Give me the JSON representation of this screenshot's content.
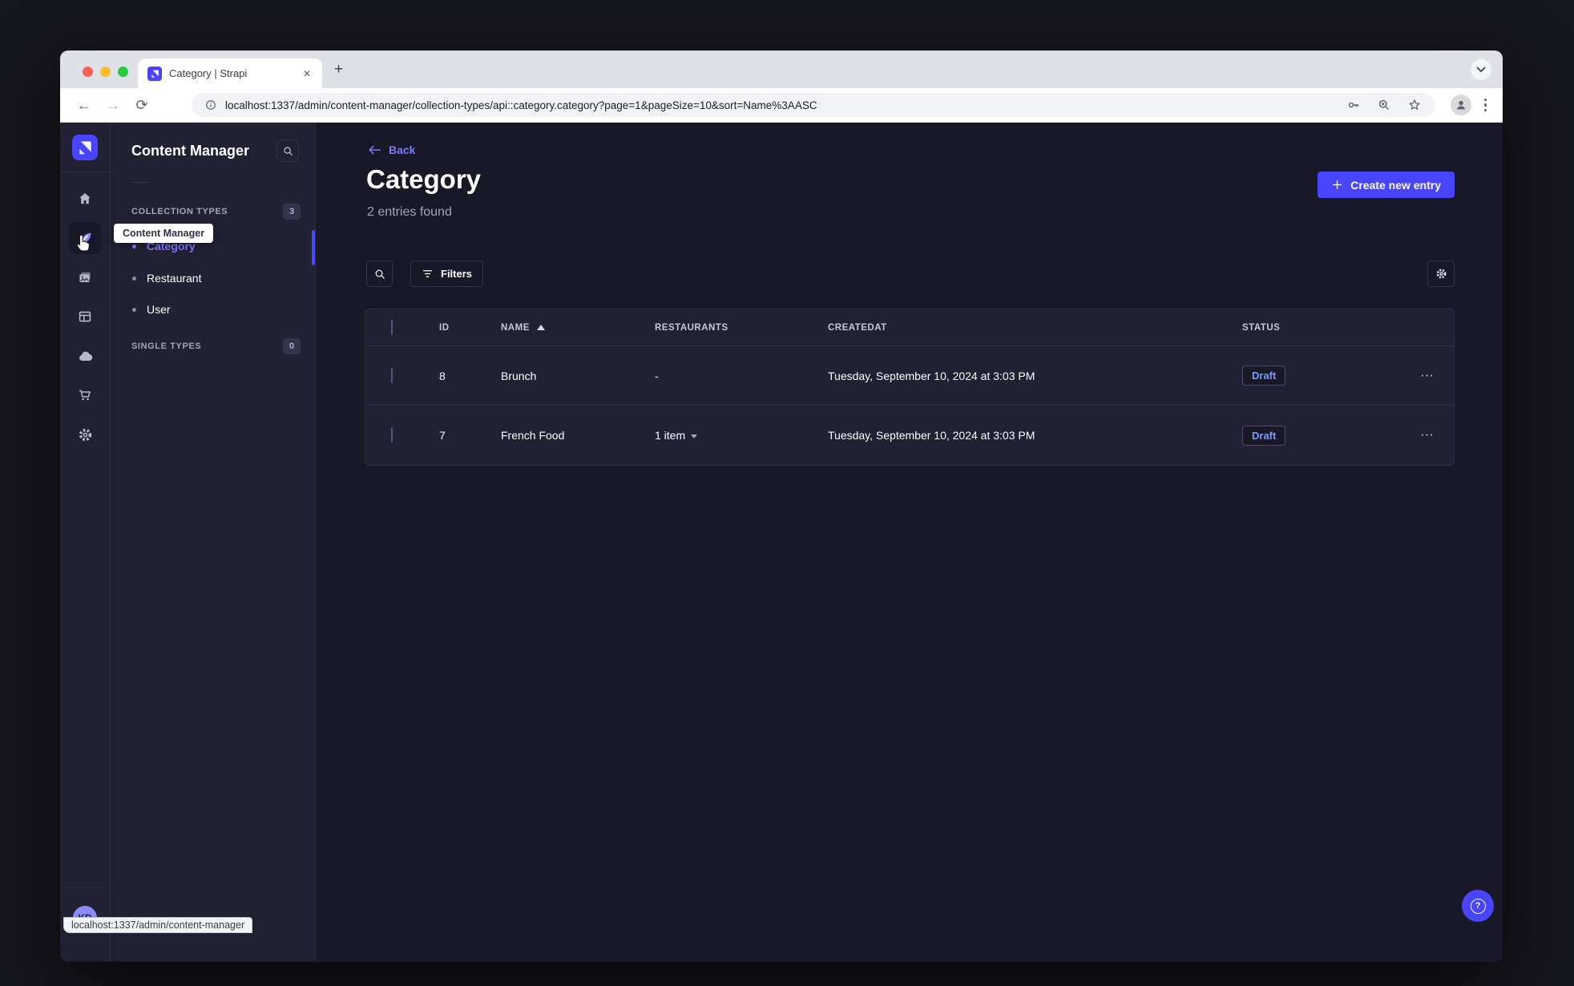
{
  "browser": {
    "tab_title": "Category | Strapi",
    "url": "localhost:1337/admin/content-manager/collection-types/api::category.category?page=1&pageSize=10&sort=Name%3AASC",
    "status_bubble": "localhost:1337/admin/content-manager"
  },
  "glyphs": {
    "back": "←",
    "forward": "→",
    "reload": "⟳",
    "close": "✕",
    "new_tab": "+",
    "row_menu": "⋯",
    "help": "?"
  },
  "sidebar": {
    "title": "Content Manager",
    "tooltip": "Content Manager",
    "collection_types": {
      "label": "COLLECTION TYPES",
      "count": "3",
      "items": [
        {
          "label": "Category"
        },
        {
          "label": "Restaurant"
        },
        {
          "label": "User"
        }
      ]
    },
    "single_types": {
      "label": "SINGLE TYPES",
      "count": "0"
    }
  },
  "user": {
    "initials": "KD"
  },
  "main": {
    "back": "Back",
    "title": "Category",
    "subtitle": "2 entries found",
    "create_button": "Create new entry",
    "filters": "Filters",
    "table": {
      "headers": {
        "id": "ID",
        "name": "NAME",
        "restaurants": "RESTAURANTS",
        "createdat": "CREATEDAT",
        "status": "STATUS"
      },
      "rows": [
        {
          "id": "8",
          "name": "Brunch",
          "restaurants": "-",
          "createdat": "Tuesday, September 10, 2024 at 3:03 PM",
          "status": "Draft"
        },
        {
          "id": "7",
          "name": "French Food",
          "restaurants": "1 item",
          "createdat": "Tuesday, September 10, 2024 at 3:03 PM",
          "status": "Draft"
        }
      ]
    }
  },
  "colors": {
    "primary": "#4945ff",
    "primary_light": "#7b79ff",
    "draft_text": "#7b9aff",
    "surface": "#212134",
    "background": "#181826",
    "border": "#32324d"
  }
}
